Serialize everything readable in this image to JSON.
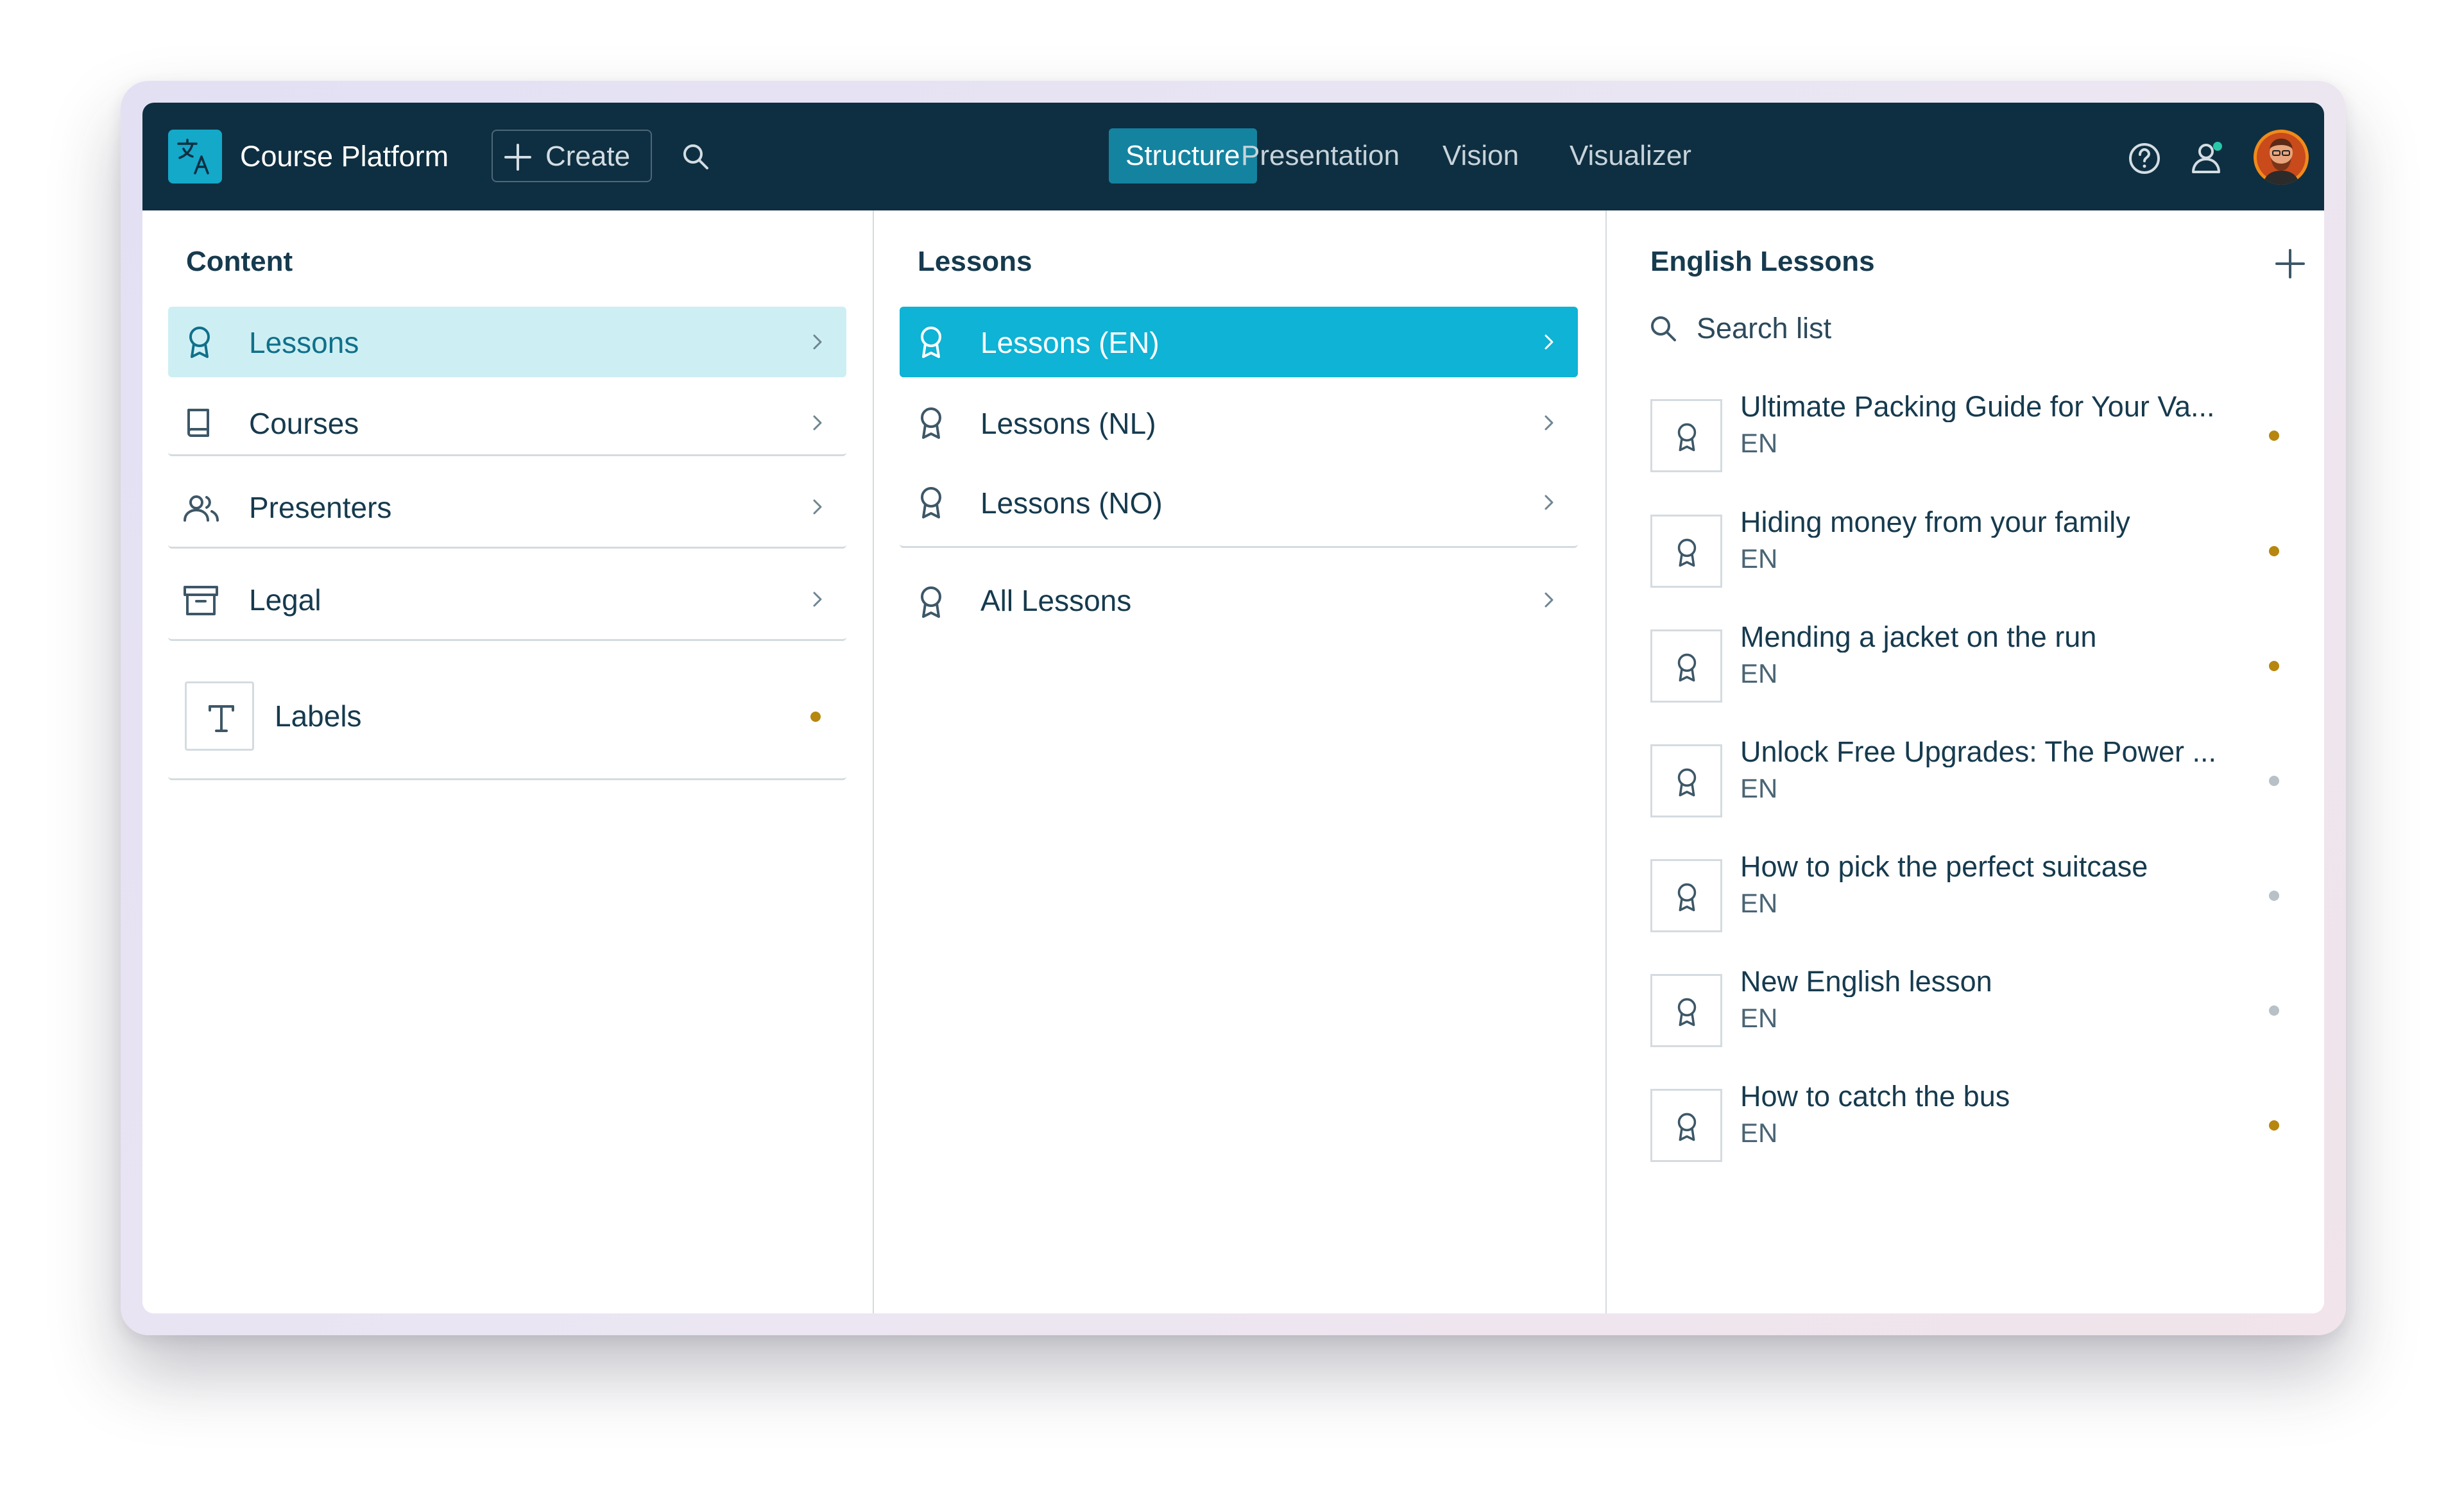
{
  "app": {
    "name": "Course Platform",
    "create_label": "Create"
  },
  "nav": {
    "tabs": [
      {
        "label": "Structure",
        "active": true
      },
      {
        "label": "Presentation",
        "active": false
      },
      {
        "label": "Vision",
        "active": false
      },
      {
        "label": "Visualizer",
        "active": false
      }
    ]
  },
  "content_pane": {
    "title": "Content",
    "items": [
      {
        "label": "Lessons",
        "icon": "award-icon",
        "selected": true
      },
      {
        "label": "Courses",
        "icon": "book-icon"
      },
      {
        "label": "Presenters",
        "icon": "users-icon"
      },
      {
        "label": "Legal",
        "icon": "archive-icon"
      },
      {
        "label": "Labels",
        "icon": "text-icon",
        "status": "changed"
      }
    ]
  },
  "lessons_pane": {
    "title": "Lessons",
    "items": [
      {
        "label": "Lessons (EN)",
        "selected": true
      },
      {
        "label": "Lessons (NL)"
      },
      {
        "label": "Lessons (NO)"
      },
      {
        "label": "All Lessons"
      }
    ]
  },
  "english_pane": {
    "title": "English Lessons",
    "search_placeholder": "Search list",
    "items": [
      {
        "title": "Ultimate Packing Guide for Your Va...",
        "lang": "EN",
        "status": "changed"
      },
      {
        "title": "Hiding money from your family",
        "lang": "EN",
        "status": "changed"
      },
      {
        "title": "Mending a jacket on the run",
        "lang": "EN",
        "status": "changed"
      },
      {
        "title": "Unlock Free Upgrades: The Power ...",
        "lang": "EN",
        "status": "unpublished"
      },
      {
        "title": "How to pick the perfect suitcase",
        "lang": "EN",
        "status": "unpublished"
      },
      {
        "title": "New English lesson",
        "lang": "EN",
        "status": "unpublished"
      },
      {
        "title": "How to catch the bus",
        "lang": "EN",
        "status": "changed"
      }
    ]
  },
  "colors": {
    "topbar": "#0e2f41",
    "accent": "#0eb3d5",
    "selected_light": "#cdeff4",
    "status_changed": "#b7860f",
    "status_unpublished": "#b8c1c7"
  }
}
